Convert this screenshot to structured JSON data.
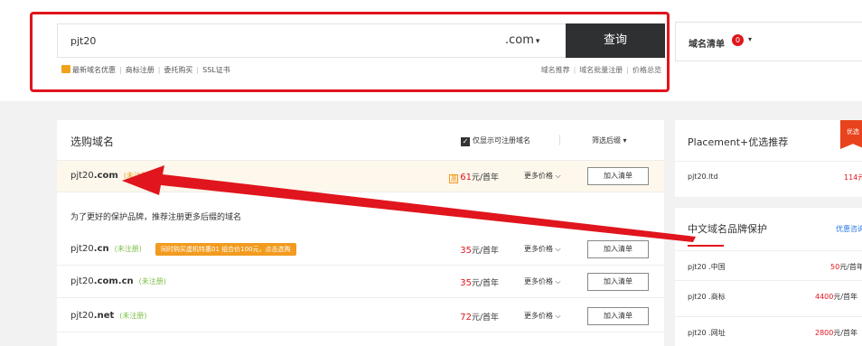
{
  "search": {
    "value": "pjt20",
    "tld": ".com",
    "query_label": "查询"
  },
  "quick_links": [
    "最新域名优惠",
    "商标注册",
    "委托购买",
    "SSL证书"
  ],
  "helper_links": [
    "域名推荐",
    "域名批量注册",
    "价格总览"
  ],
  "cart": {
    "label": "域名清单",
    "count": "0"
  },
  "main": {
    "title": "选购域名",
    "only_available_label": "仅显示可注册域名",
    "filter_suffix_label": "筛选后缀",
    "suggest_text": "为了更好的保护品牌，推荐注册更多后缀的域名",
    "more_label": "更多价格",
    "add_label": "加入清单",
    "unit": "元/首年",
    "rows": [
      {
        "prefix": "pjt20",
        "tld": ".com",
        "status": "(未注册)",
        "price": "61",
        "promo": ""
      },
      {
        "prefix": "pjt20",
        "tld": ".cn",
        "status": "(未注册)",
        "price": "35",
        "promo": "同时购买虚机特惠01 组合价100元，点击选购"
      },
      {
        "prefix": "pjt20",
        "tld": ".com.cn",
        "status": "(未注册)",
        "price": "35",
        "promo": ""
      },
      {
        "prefix": "pjt20",
        "tld": ".net",
        "status": "(未注册)",
        "price": "72",
        "promo": ""
      }
    ]
  },
  "side1": {
    "title": "Placement+优选推荐",
    "ribbon": "优选",
    "row_name": "pjt20.ltd",
    "row_price": "114元"
  },
  "side2": {
    "title": "中文域名品牌保护",
    "link": "优惠咨询",
    "rows": [
      {
        "name": "pjt20 .中国",
        "price": "50",
        "unit": "元/首年"
      },
      {
        "name": "pjt20 .商标",
        "price": "4400",
        "unit": "元/首年"
      },
      {
        "name": "pjt20 .网址",
        "price": "2800",
        "unit": "元/首年"
      }
    ]
  },
  "colors": {
    "accent_red": "#e0151d",
    "promo_orange": "#f29b1e",
    "available_green": "#7fbf47"
  }
}
